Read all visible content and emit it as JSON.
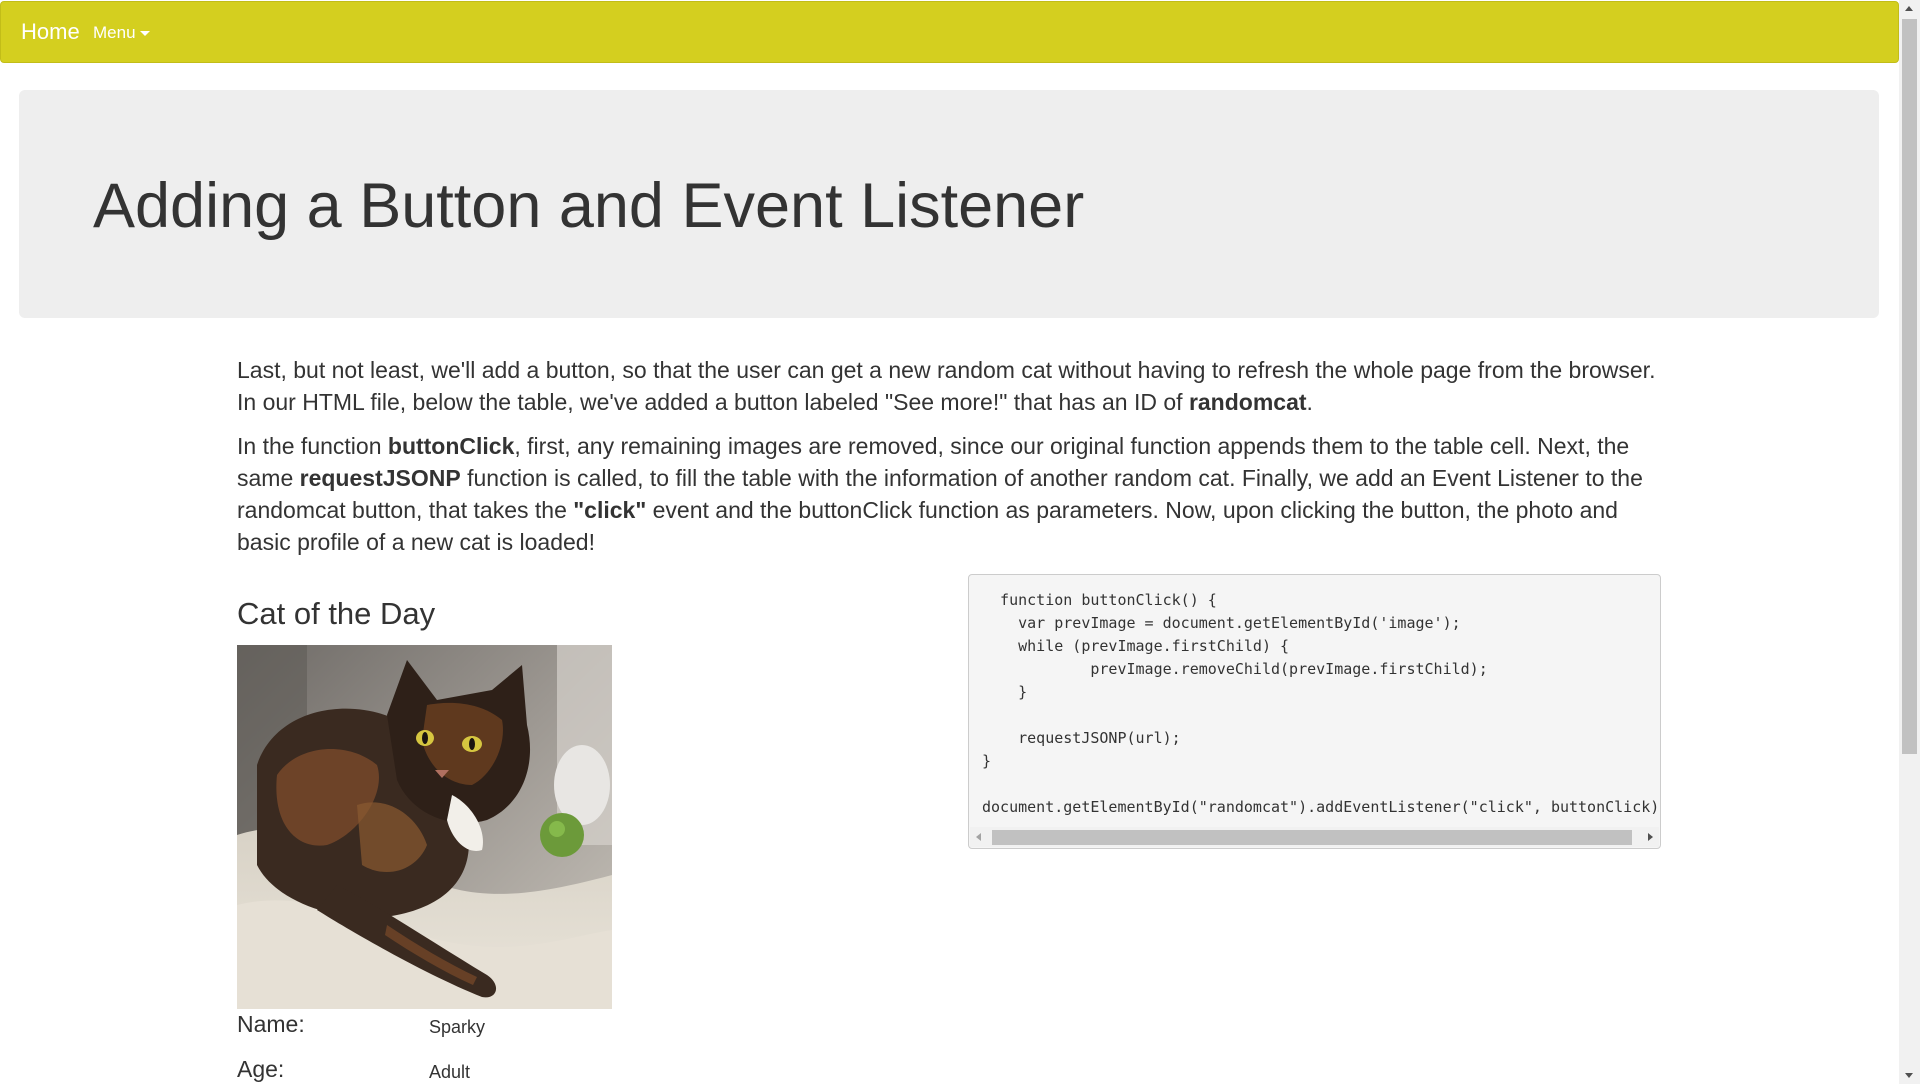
{
  "navbar": {
    "home_label": "Home",
    "menu_label": "Menu",
    "background_color": "#d4cf1f"
  },
  "header": {
    "title": "Adding a Button and Event Listener"
  },
  "content": {
    "paragraph1": {
      "part1": "Last, but not least, we'll add a button, so that the user can get a new random cat without having to refresh the whole page from the browser. In our HTML file, below the table, we've added a button labeled \"See more!\" that has an ID of ",
      "bold1": "randomcat",
      "part2": "."
    },
    "paragraph2": {
      "part1": "In the function ",
      "bold1": "buttonClick",
      "part2": ", first, any remaining images are removed, since our original function appends them to the table cell. Next, the same ",
      "bold2": "requestJSONP",
      "part3": " function is called, to fill the table with the information of another random cat. Finally, we add an Event Listener to the randomcat button, that takes the ",
      "bold3": "\"click\"",
      "part4": " event and the buttonClick function as parameters. Now, upon clicking the button, the photo and basic profile of a new cat is loaded!"
    }
  },
  "cat_section": {
    "heading": "Cat of the Day",
    "profile": [
      {
        "label": "Name:",
        "value": "Sparky"
      },
      {
        "label": "Age:",
        "value": "Adult"
      }
    ]
  },
  "code": {
    "lines": "  function buttonClick() {\n    var prevImage = document.getElementById('image');\n    while (prevImage.firstChild) {\n            prevImage.removeChild(prevImage.firstChild);\n    }\n\n    requestJSONP(url);\n}\n\ndocument.getElementById(\"randomcat\").addEventListener(\"click\", buttonClick);"
  },
  "icons": {
    "menu_caret": "caret-down-icon",
    "scroll_up": "arrow-up-icon",
    "scroll_down": "arrow-down-icon",
    "scroll_left": "arrow-left-icon",
    "scroll_right": "arrow-right-icon"
  }
}
